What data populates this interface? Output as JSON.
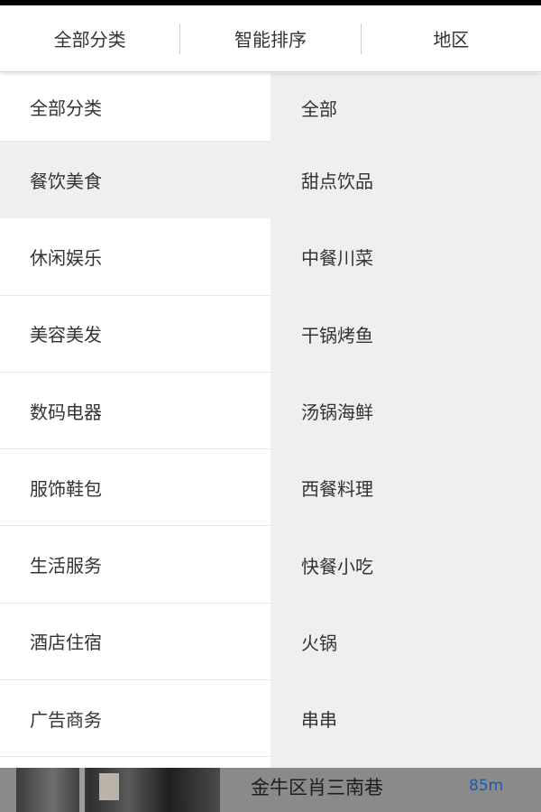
{
  "filter_bar": {
    "tabs": [
      {
        "label": "全部分类"
      },
      {
        "label": "智能排序"
      },
      {
        "label": "地区"
      }
    ]
  },
  "categories": [
    {
      "label": "全部分类",
      "selected": false
    },
    {
      "label": "餐饮美食",
      "selected": true
    },
    {
      "label": "休闲娱乐",
      "selected": false
    },
    {
      "label": "美容美发",
      "selected": false
    },
    {
      "label": "数码电器",
      "selected": false
    },
    {
      "label": "服饰鞋包",
      "selected": false
    },
    {
      "label": "生活服务",
      "selected": false
    },
    {
      "label": "酒店住宿",
      "selected": false
    },
    {
      "label": "广告商务",
      "selected": false
    }
  ],
  "subcategories": [
    {
      "label": "全部"
    },
    {
      "label": "甜点饮品"
    },
    {
      "label": "中餐川菜"
    },
    {
      "label": "干锅烤鱼"
    },
    {
      "label": "汤锅海鲜"
    },
    {
      "label": "西餐料理"
    },
    {
      "label": "快餐小吃"
    },
    {
      "label": "火锅"
    },
    {
      "label": "串串"
    }
  ],
  "listing_preview": {
    "address": "金牛区肖三南巷",
    "distance": "85m"
  },
  "colors": {
    "selected_bg": "#efefef",
    "distance_text": "#1a5aa8"
  }
}
